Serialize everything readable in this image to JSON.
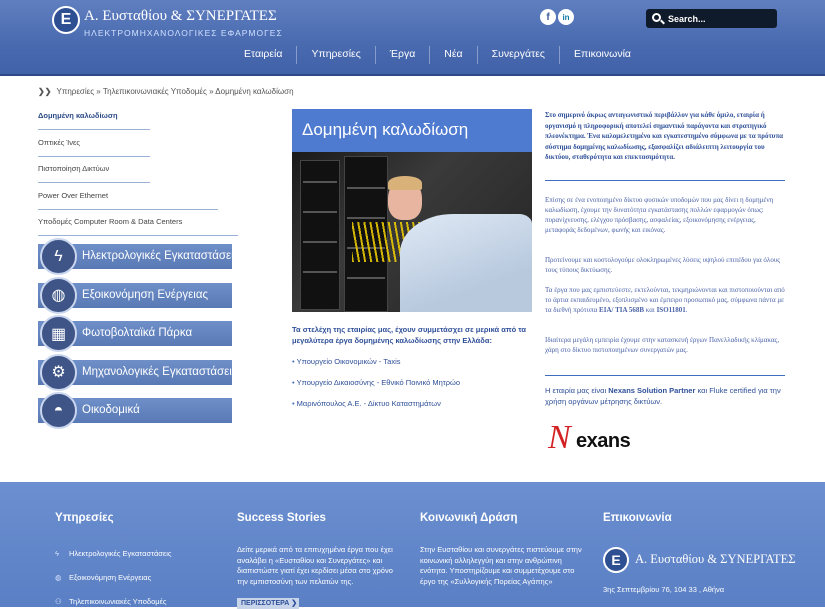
{
  "header": {
    "logo_name": "Α. Ευσταθίου & ΣΥΝΕΡΓΑΤΕΣ",
    "logo_sub": "ΗΛΕΚΤΡΟΜΗΧΑΝΟΛΟΓΙΚΕΣ ΕΦΑΡΜΟΓΕΣ",
    "logo_mark": "Ε",
    "social": {
      "facebook": "f",
      "linkedin": "in"
    },
    "search_placeholder": "Search...",
    "nav": [
      "Εταιρεία",
      "Υπηρεσίες",
      "Έργα",
      "Νέα",
      "Συνεργάτες",
      "Επικοινωνία"
    ]
  },
  "breadcrumb": {
    "arrows": "❯❯",
    "items": [
      "Υπηρεσίες",
      "Τηλεπικοινωνιακές Υποδομές",
      "Δομημένη καλωδίωση"
    ],
    "separator": "»"
  },
  "submenu": [
    "Δομημένη καλωδίωση",
    "Οπτικές Ίνες",
    "Πιστοποίηση Δικτύων",
    "Power Over Ethernet",
    "Υποδομές Computer Room & Data Centers"
  ],
  "categories": [
    {
      "label": "Ηλεκτρολογικές Εγκαταστάσεις",
      "icon": "lightning-icon"
    },
    {
      "label": "Εξοικονόμηση Ενέργειας",
      "icon": "bulb-icon"
    },
    {
      "label": "Φωτοβολταϊκά Πάρκα",
      "icon": "solar-panel-icon"
    },
    {
      "label": "Μηχανολογικές Εγκαταστάσεις",
      "icon": "gear-icon"
    },
    {
      "label": "Οικοδομικά",
      "icon": "helmet-icon"
    }
  ],
  "hero": {
    "title": "Δομημένη καλωδίωση"
  },
  "intro": "Τα στελέχη της εταιρίας μας, έχουν συμμετάσχει σε μερικά από τα μεγαλύτερα έργα δομημένης καλωδίωσης στην Ελλάδα:",
  "projects": [
    "Υπουργείο Οικονομικών - Taxis",
    "Υπουργείο Δικαιοσύνης - Εθνικό Ποινικό Μητρώο",
    "Μαρινόπουλος Α.Ε. - Δίκτυο Καταστημάτων"
  ],
  "right": {
    "lead": "Στο σημερινό άκρως ανταγωνιστικό περιβάλλον για κάθε όμιλο, εταιρία ή οργανισμό η πληροφορική αποτελεί σημαντικό παράγοντα και στρατηγικό πλεονέκτημα. Ένα καλομελετημένο και εγκατεστημένο σύμφωνα με τα πρότυπα σύστημα δομημένης καλωδίωσης, εξασφαλίζει αδιάλειπτη λειτουργία του δικτύου, σταθερότητα και επεκτασιμότητα.",
    "p1": "Επίσης σε ένα ενοποιημένο δίκτυο φυσικών υποδομών που μας δίνει η δομημένη καλωδίωση, έχουμε την δυνατότητα εγκατάστασης πολλών εφαρμογών όπως: πυρανίχνευσης, ελέγχου πρόσβασης, ασφαλείας, εξοικονόμησης ενέργειας, μεταφοράς δεδομένων, φωνής και εικόνας.",
    "p2": "Προτείνουμε και κοστολογούμε ολοκληρωμένες λύσεις υψηλού επιπέδου για όλους τους τύπους δικτύωσης.",
    "p3_start": "Τα έργα που μας εμπιστεύεστε, εκτελούνται, τεκμηριώνονται και πιστοποιούνται από το άρτια εκπαιδευμένο, εξοπλισμένο και έμπειρο προσωπικό μας, σύμφωνα πάντα με τα διεθνή πρότυπα ",
    "p3_std1": "EIA/ TIA 568B",
    "p3_and": " και ",
    "p3_std2": "ISO11801",
    "p3_end": ".",
    "p4": "Ιδιαίτερα μεγάλη εμπειρία έχουμε στην κατασκευή έργων Πανελλαδικής κλίμακας, χάρη στο δίκτυο πιστοποιημένων συνεργατών μας.",
    "partner_start": "Η εταιρία μας είναι ",
    "partner_bold": "Nexans Solution Partner",
    "partner_end": " και Fluke certified για την χρήση οργάνων μέτρησης δικτύων.",
    "nexans_word": "exans",
    "nexans_n": "N"
  },
  "footer": {
    "services_title": "Υπηρεσίες",
    "services": [
      {
        "label": "Ηλεκτρολογικές Εγκαταστάσεις",
        "icon": "ϟ"
      },
      {
        "label": "Εξοικονόμηση Ενέργειας",
        "icon": "◍"
      },
      {
        "label": "Τηλεπικοινωνιακές Υποδομές",
        "icon": "⚇"
      }
    ],
    "success_title": "Success Stories",
    "success_text": "Δείτε μερικά από τα επιτυχημένα έργα που έχει αναλάβει η «Ευσταθίου και Συνεργάτες» και διαπιστώστε γιατί έχει κερδίσει μέσα στο χρόνο την εμπιστοσύνη των πελατών της.",
    "more_label": "ΠΕΡΙΣΣΟΤΕΡΑ ❯",
    "social_title": "Κοινωνική Δράση",
    "social_text": "Στην Ευσταθίου και συνεργάτες πιστεύουμε στην κοινωνική αλληλεγγύη και στην ανθρώπινη ενότητα. Υποστηρίζουμε και συμμετέχουμε στο έργο της «Συλλογικής Πορείας Αγάπης»",
    "contact_title": "Επικοινωνία",
    "contact_logo_name": "Α. Ευσταθίου & ΣΥΝΕΡΓΑΤΕΣ",
    "contact_logo_mark": "Ε",
    "address": "3ης Σεπτεμβρίου 76, 104 33 , Αθήνα"
  }
}
